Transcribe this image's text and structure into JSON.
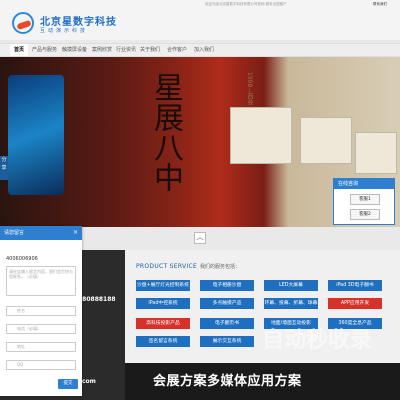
{
  "header": {
    "logo_title": "北京星数字科技",
    "logo_subtitle": "互动演示科技",
    "top_notice": "欢迎光临北京星数字科技有限公司官网 服务全国客户",
    "top_contact": "联系我们"
  },
  "nav": {
    "items": [
      "首页",
      "产品与服务",
      "触摸屏设备",
      "案例欣赏",
      "行业资讯",
      "关于我们",
      "合作客户",
      "加入我们"
    ]
  },
  "banner": {
    "calligraphy": "星展八中",
    "year_text": "1998—西会",
    "scroll_up": "︿"
  },
  "share": {
    "label": "分享"
  },
  "service": {
    "title": "在线咨询",
    "buttons": [
      "客服1",
      "客服2"
    ]
  },
  "form": {
    "title": "请您留言",
    "close": "×",
    "phone": "4006006906",
    "textarea_placeholder": "请在此输入留言内容，我们会尽快与您联系。（必填）",
    "fields": [
      "姓名",
      "电话（必填）",
      "地址",
      "QQ"
    ],
    "submit": "提交"
  },
  "contact": {
    "tel": "580888188",
    "tel2": "：",
    "site": "com"
  },
  "product": {
    "title": "PRODUCT SERVICE",
    "subtitle": "我们的服务包括：",
    "items": [
      "沙盘+展厅灯光控制系统",
      "电子相册沙盘",
      "LED大屏幕",
      "iPad 3D电子翻书",
      "iPad中控系统",
      "多点触摸产品",
      "环幕、投幕、折幕、球幕",
      "APP应用开发",
      "高科技投影产品",
      "电子翻页书",
      "地面/墙面互动投影",
      "360度全息产品",
      "签名留言系统",
      "展示交互系统"
    ]
  },
  "slogan": "会展方案多媒体应用方案",
  "watermark": "自动秒收录"
}
